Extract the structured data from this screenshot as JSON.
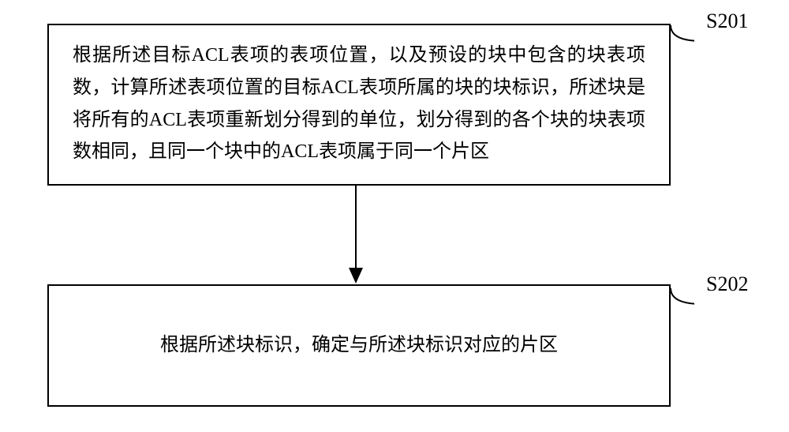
{
  "chart_data": {
    "type": "flowchart",
    "steps": [
      {
        "id": "S201",
        "text": "根据所述目标ACL表项的表项位置，以及预设的块中包含的块表项数，计算所述表项位置的目标ACL表项所属的块的块标识，所述块是将所有的ACL表项重新划分得到的单位，划分得到的各个块的块表项数相同，且同一个块中的ACL表项属于同一个片区"
      },
      {
        "id": "S202",
        "text": "根据所述块标识，确定与所述块标识对应的片区"
      }
    ],
    "connections": [
      {
        "from": "S201",
        "to": "S202"
      }
    ]
  }
}
